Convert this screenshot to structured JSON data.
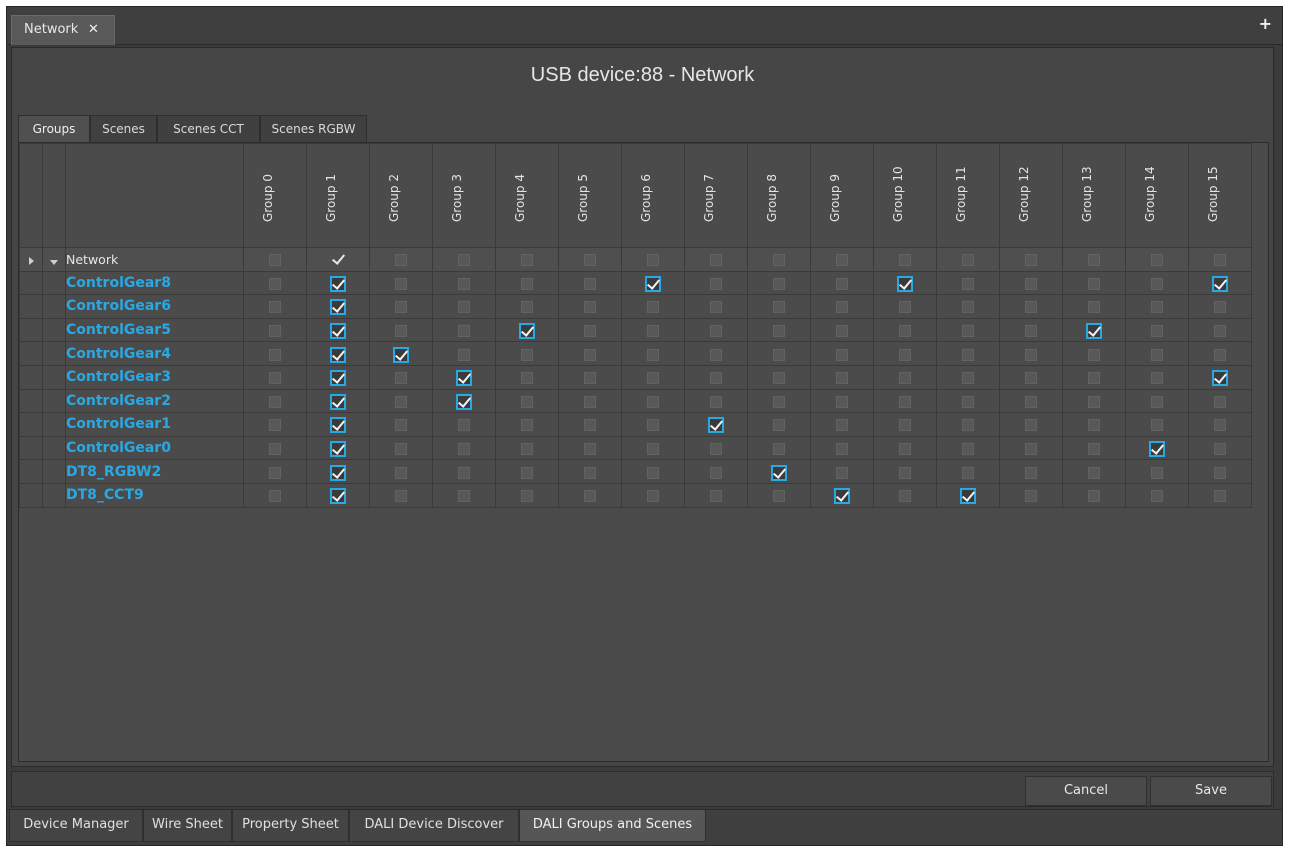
{
  "top_tab": {
    "label": "Network",
    "close": "✕"
  },
  "add_glyph": "+",
  "title": "USB device:88 - Network",
  "inner_tabs": [
    "Groups",
    "Scenes",
    "Scenes CCT",
    "Scenes RGBW"
  ],
  "active_inner_tab": "Groups",
  "columns": [
    "Group 0",
    "Group 1",
    "Group 2",
    "Group 3",
    "Group 4",
    "Group 5",
    "Group 6",
    "Group 7",
    "Group 8",
    "Group 9",
    "Group 10",
    "Group 11",
    "Group 12",
    "Group 13",
    "Group 14",
    "Group 15"
  ],
  "root": {
    "label": "Network",
    "checked_groups": [
      1
    ]
  },
  "rows": [
    {
      "label": "ControlGear8",
      "checked": [
        1,
        6,
        10,
        15
      ]
    },
    {
      "label": "ControlGear6",
      "checked": [
        1
      ]
    },
    {
      "label": "ControlGear5",
      "checked": [
        1,
        4,
        13
      ]
    },
    {
      "label": "ControlGear4",
      "checked": [
        1,
        2
      ]
    },
    {
      "label": "ControlGear3",
      "checked": [
        1,
        3,
        15
      ]
    },
    {
      "label": "ControlGear2",
      "checked": [
        1,
        3
      ]
    },
    {
      "label": "ControlGear1",
      "checked": [
        1,
        7
      ]
    },
    {
      "label": "ControlGear0",
      "checked": [
        1,
        14
      ]
    },
    {
      "label": "DT8_RGBW2",
      "checked": [
        1,
        8
      ]
    },
    {
      "label": "DT8_CCT9",
      "checked": [
        1,
        9,
        11
      ]
    }
  ],
  "buttons": {
    "cancel": "Cancel",
    "save": "Save"
  },
  "bottom_tabs": [
    "Device Manager",
    "Wire Sheet",
    "Property Sheet",
    "DALI Device Discover",
    "DALI Groups and Scenes"
  ],
  "active_bottom_tab": "DALI Groups and Scenes",
  "colors": {
    "accent": "#29a9e3",
    "background": "#3b3b3b"
  }
}
